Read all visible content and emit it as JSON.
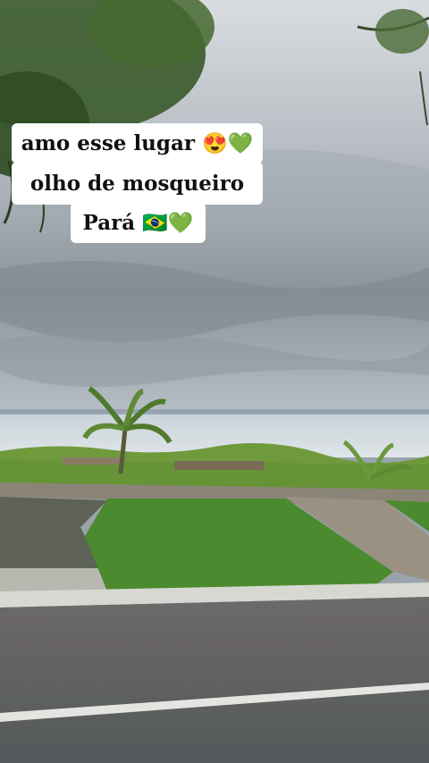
{
  "caption": {
    "line1": "amo esse lugar 😍💚",
    "line2": "olho de mosqueiro",
    "line3": "Pará 🇧🇷💚"
  },
  "colors": {
    "sky": "#9ea6ae",
    "water": "#cdd6dc",
    "grass": "#4f8a34",
    "road": "#5c5f60",
    "caption_bg": "#ffffff",
    "caption_text": "#111111"
  }
}
